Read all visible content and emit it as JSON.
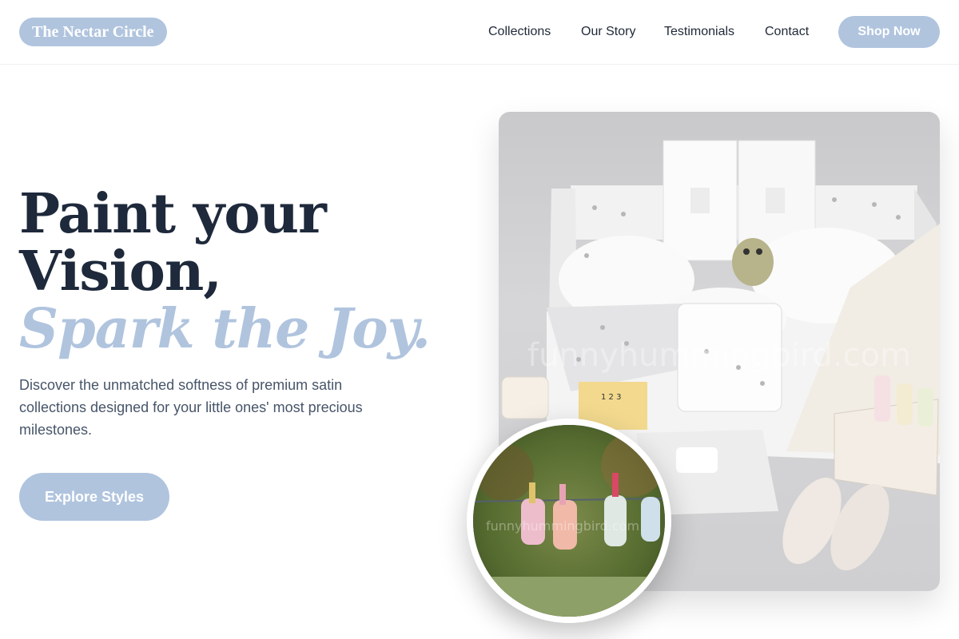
{
  "brand": {
    "name": "The Nectar Circle"
  },
  "nav": {
    "links": [
      "Collections",
      "Our Story",
      "Testimonials",
      "Contact"
    ],
    "cta": "Shop Now"
  },
  "hero": {
    "headline_line1": "Paint your",
    "headline_line2": "Vision,",
    "headline_accent": "Spark the Joy.",
    "subtext": "Discover the unmatched softness of premium satin collections designed for your little ones' most precious milestones.",
    "cta": "Explore Styles"
  },
  "images": {
    "main": {
      "icon": "baby-gift-box-photo",
      "watermark": "funnyhummingbird.com"
    },
    "circle": {
      "icon": "baby-socks-clothesline-photo",
      "watermark": "funnyhummingbird.com"
    }
  },
  "colors": {
    "accent": "#b0c4de",
    "heading": "#1e293b",
    "body_text": "#475569",
    "nav_text": "#1f2937"
  }
}
